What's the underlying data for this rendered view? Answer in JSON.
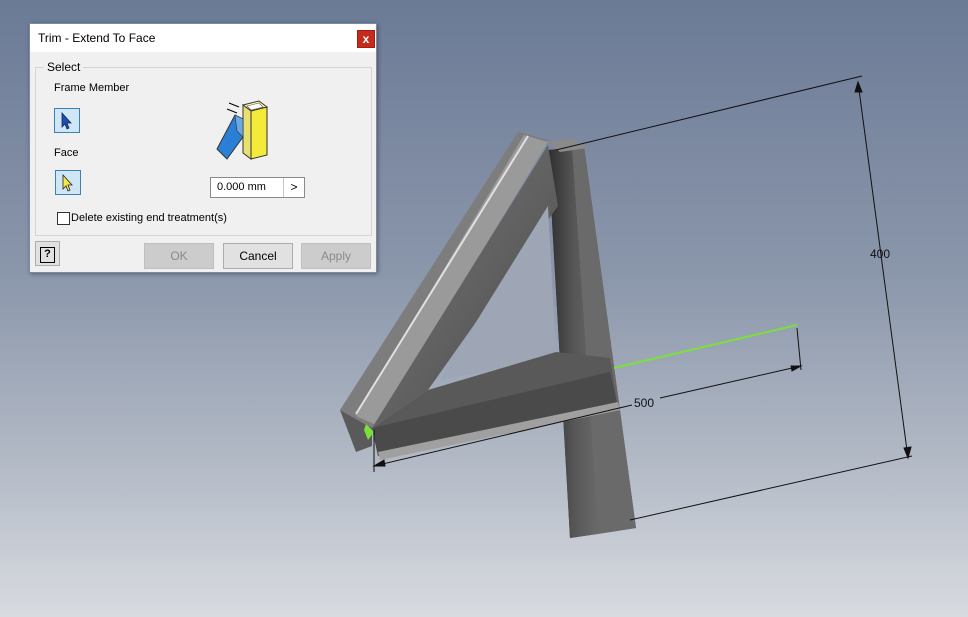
{
  "dialog": {
    "title": "Trim - Extend To Face",
    "close_label": "x",
    "group_label": "Select",
    "frame_member_label": "Frame Member",
    "face_label": "Face",
    "offset_value": "0.000 mm",
    "offset_arrow": ">",
    "delete_end_treatment_label": "Delete existing end treatment(s)",
    "delete_end_treatment_checked": false,
    "help_label": "?",
    "ok_label": "OK",
    "cancel_label": "Cancel",
    "apply_label": "Apply"
  },
  "viewport": {
    "dimension_height": "400",
    "dimension_width": "500",
    "highlight_color": "#7be03a"
  }
}
